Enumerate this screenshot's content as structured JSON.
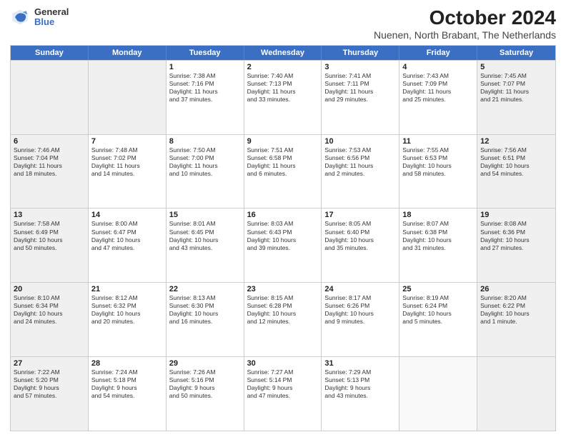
{
  "logo": {
    "general": "General",
    "blue": "Blue"
  },
  "title": "October 2024",
  "subtitle": "Nuenen, North Brabant, The Netherlands",
  "header_days": [
    "Sunday",
    "Monday",
    "Tuesday",
    "Wednesday",
    "Thursday",
    "Friday",
    "Saturday"
  ],
  "rows": [
    [
      {
        "day": "",
        "text": "",
        "shaded": true
      },
      {
        "day": "",
        "text": "",
        "shaded": true
      },
      {
        "day": "1",
        "text": "Sunrise: 7:38 AM\nSunset: 7:16 PM\nDaylight: 11 hours\nand 37 minutes.",
        "shaded": false
      },
      {
        "day": "2",
        "text": "Sunrise: 7:40 AM\nSunset: 7:13 PM\nDaylight: 11 hours\nand 33 minutes.",
        "shaded": false
      },
      {
        "day": "3",
        "text": "Sunrise: 7:41 AM\nSunset: 7:11 PM\nDaylight: 11 hours\nand 29 minutes.",
        "shaded": false
      },
      {
        "day": "4",
        "text": "Sunrise: 7:43 AM\nSunset: 7:09 PM\nDaylight: 11 hours\nand 25 minutes.",
        "shaded": false
      },
      {
        "day": "5",
        "text": "Sunrise: 7:45 AM\nSunset: 7:07 PM\nDaylight: 11 hours\nand 21 minutes.",
        "shaded": true
      }
    ],
    [
      {
        "day": "6",
        "text": "Sunrise: 7:46 AM\nSunset: 7:04 PM\nDaylight: 11 hours\nand 18 minutes.",
        "shaded": true
      },
      {
        "day": "7",
        "text": "Sunrise: 7:48 AM\nSunset: 7:02 PM\nDaylight: 11 hours\nand 14 minutes.",
        "shaded": false
      },
      {
        "day": "8",
        "text": "Sunrise: 7:50 AM\nSunset: 7:00 PM\nDaylight: 11 hours\nand 10 minutes.",
        "shaded": false
      },
      {
        "day": "9",
        "text": "Sunrise: 7:51 AM\nSunset: 6:58 PM\nDaylight: 11 hours\nand 6 minutes.",
        "shaded": false
      },
      {
        "day": "10",
        "text": "Sunrise: 7:53 AM\nSunset: 6:56 PM\nDaylight: 11 hours\nand 2 minutes.",
        "shaded": false
      },
      {
        "day": "11",
        "text": "Sunrise: 7:55 AM\nSunset: 6:53 PM\nDaylight: 10 hours\nand 58 minutes.",
        "shaded": false
      },
      {
        "day": "12",
        "text": "Sunrise: 7:56 AM\nSunset: 6:51 PM\nDaylight: 10 hours\nand 54 minutes.",
        "shaded": true
      }
    ],
    [
      {
        "day": "13",
        "text": "Sunrise: 7:58 AM\nSunset: 6:49 PM\nDaylight: 10 hours\nand 50 minutes.",
        "shaded": true
      },
      {
        "day": "14",
        "text": "Sunrise: 8:00 AM\nSunset: 6:47 PM\nDaylight: 10 hours\nand 47 minutes.",
        "shaded": false
      },
      {
        "day": "15",
        "text": "Sunrise: 8:01 AM\nSunset: 6:45 PM\nDaylight: 10 hours\nand 43 minutes.",
        "shaded": false
      },
      {
        "day": "16",
        "text": "Sunrise: 8:03 AM\nSunset: 6:43 PM\nDaylight: 10 hours\nand 39 minutes.",
        "shaded": false
      },
      {
        "day": "17",
        "text": "Sunrise: 8:05 AM\nSunset: 6:40 PM\nDaylight: 10 hours\nand 35 minutes.",
        "shaded": false
      },
      {
        "day": "18",
        "text": "Sunrise: 8:07 AM\nSunset: 6:38 PM\nDaylight: 10 hours\nand 31 minutes.",
        "shaded": false
      },
      {
        "day": "19",
        "text": "Sunrise: 8:08 AM\nSunset: 6:36 PM\nDaylight: 10 hours\nand 27 minutes.",
        "shaded": true
      }
    ],
    [
      {
        "day": "20",
        "text": "Sunrise: 8:10 AM\nSunset: 6:34 PM\nDaylight: 10 hours\nand 24 minutes.",
        "shaded": true
      },
      {
        "day": "21",
        "text": "Sunrise: 8:12 AM\nSunset: 6:32 PM\nDaylight: 10 hours\nand 20 minutes.",
        "shaded": false
      },
      {
        "day": "22",
        "text": "Sunrise: 8:13 AM\nSunset: 6:30 PM\nDaylight: 10 hours\nand 16 minutes.",
        "shaded": false
      },
      {
        "day": "23",
        "text": "Sunrise: 8:15 AM\nSunset: 6:28 PM\nDaylight: 10 hours\nand 12 minutes.",
        "shaded": false
      },
      {
        "day": "24",
        "text": "Sunrise: 8:17 AM\nSunset: 6:26 PM\nDaylight: 10 hours\nand 9 minutes.",
        "shaded": false
      },
      {
        "day": "25",
        "text": "Sunrise: 8:19 AM\nSunset: 6:24 PM\nDaylight: 10 hours\nand 5 minutes.",
        "shaded": false
      },
      {
        "day": "26",
        "text": "Sunrise: 8:20 AM\nSunset: 6:22 PM\nDaylight: 10 hours\nand 1 minute.",
        "shaded": true
      }
    ],
    [
      {
        "day": "27",
        "text": "Sunrise: 7:22 AM\nSunset: 5:20 PM\nDaylight: 9 hours\nand 57 minutes.",
        "shaded": true
      },
      {
        "day": "28",
        "text": "Sunrise: 7:24 AM\nSunset: 5:18 PM\nDaylight: 9 hours\nand 54 minutes.",
        "shaded": false
      },
      {
        "day": "29",
        "text": "Sunrise: 7:26 AM\nSunset: 5:16 PM\nDaylight: 9 hours\nand 50 minutes.",
        "shaded": false
      },
      {
        "day": "30",
        "text": "Sunrise: 7:27 AM\nSunset: 5:14 PM\nDaylight: 9 hours\nand 47 minutes.",
        "shaded": false
      },
      {
        "day": "31",
        "text": "Sunrise: 7:29 AM\nSunset: 5:13 PM\nDaylight: 9 hours\nand 43 minutes.",
        "shaded": false
      },
      {
        "day": "",
        "text": "",
        "shaded": false
      },
      {
        "day": "",
        "text": "",
        "shaded": true
      }
    ]
  ]
}
